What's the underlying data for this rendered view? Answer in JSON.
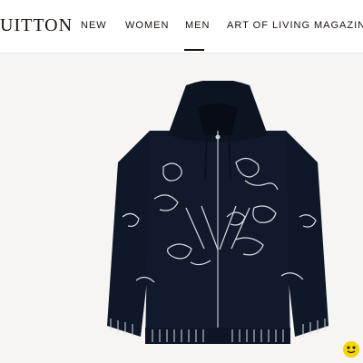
{
  "brand": {
    "logo_text": "UITTON"
  },
  "nav": {
    "items": [
      {
        "label": "NEW"
      },
      {
        "label": "WOMEN"
      },
      {
        "label": "MEN"
      },
      {
        "label": "ART OF LIVING"
      },
      {
        "label": "MAGAZINE"
      }
    ],
    "active_index": 2
  },
  "product": {
    "image": "navy-zip-hoodie-with-white-floral-embroidery",
    "colors": {
      "body": "#111a2c",
      "embroidery": "#d8dde6",
      "background": "#f6f5f3"
    }
  },
  "badge": {
    "icon": "yellow-sticker-icon",
    "color": "#f5d400"
  }
}
